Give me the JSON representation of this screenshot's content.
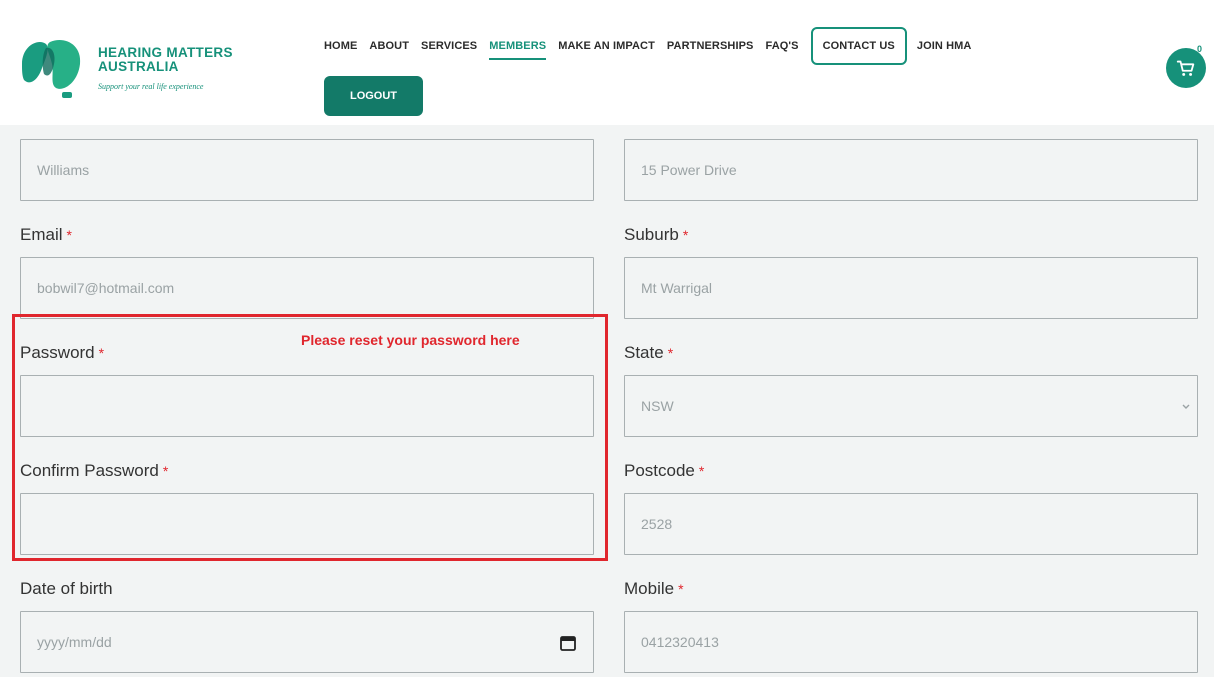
{
  "header": {
    "logo_line1": "HEARING MATTERS",
    "logo_line2": "AUSTRALIA",
    "logo_tagline": "Support your real life experience",
    "nav": [
      "HOME",
      "ABOUT",
      "SERVICES",
      "MEMBERS",
      "MAKE AN IMPACT",
      "PARTNERSHIPS",
      "FAQ'S",
      "CONTACT US",
      "JOIN HMA"
    ],
    "active_nav": "MEMBERS",
    "logout_label": "LOGOUT",
    "cart_count": "0",
    "brand_color": "#16917a"
  },
  "form": {
    "last_name_value": "Williams",
    "address_value": "15 Power Drive",
    "email_label": "Email",
    "email_value": "bobwil7@hotmail.com",
    "suburb_label": "Suburb",
    "suburb_value": "Mt Warrigal",
    "password_label": "Password",
    "confirm_password_label": "Confirm Password",
    "state_label": "State",
    "state_value": "NSW",
    "postcode_label": "Postcode",
    "postcode_value": "2528",
    "dob_label": "Date of birth",
    "dob_placeholder": "yyyy/mm/dd",
    "mobile_label": "Mobile",
    "mobile_value": "0412320413",
    "required_mark": "*",
    "annotation": "Please reset your password here",
    "annotation_color": "#e0262d"
  }
}
